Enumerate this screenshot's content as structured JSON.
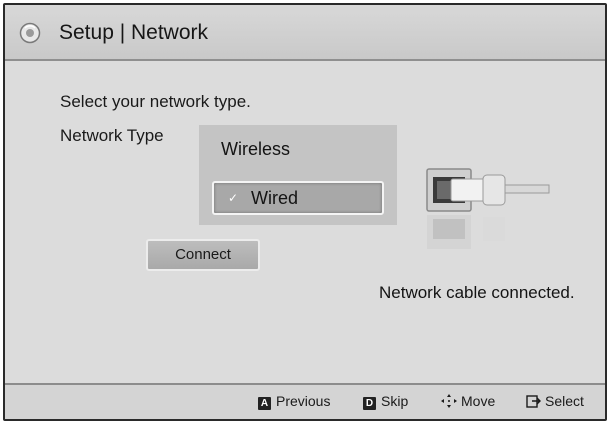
{
  "header": {
    "title": "Setup | Network",
    "icon": "gear-icon"
  },
  "main": {
    "prompt": "Select your network type.",
    "network_type_label": "Network Type",
    "options": [
      {
        "label": "Wireless",
        "selected": false
      },
      {
        "label": "Wired",
        "selected": true
      }
    ],
    "check_mark": "✓",
    "connect_label": "Connect",
    "status": "Network cable connected.",
    "status_icon": "ethernet-cable-icon"
  },
  "footer": {
    "hints": [
      {
        "key": "A",
        "label": "Previous",
        "icon": "a-button-icon"
      },
      {
        "key": "D",
        "label": "Skip",
        "icon": "d-button-icon"
      },
      {
        "key": "",
        "label": "Move",
        "icon": "move-arrows-icon"
      },
      {
        "key": "",
        "label": "Select",
        "icon": "enter-icon"
      }
    ]
  },
  "colors": {
    "background": "#dcdcdc",
    "title_bar": "#cfcfcf",
    "list_background": "#c4c4c4",
    "selected_item": "#a8a8a8",
    "border": "#2a2a2a",
    "text": "#1a1a1a"
  }
}
